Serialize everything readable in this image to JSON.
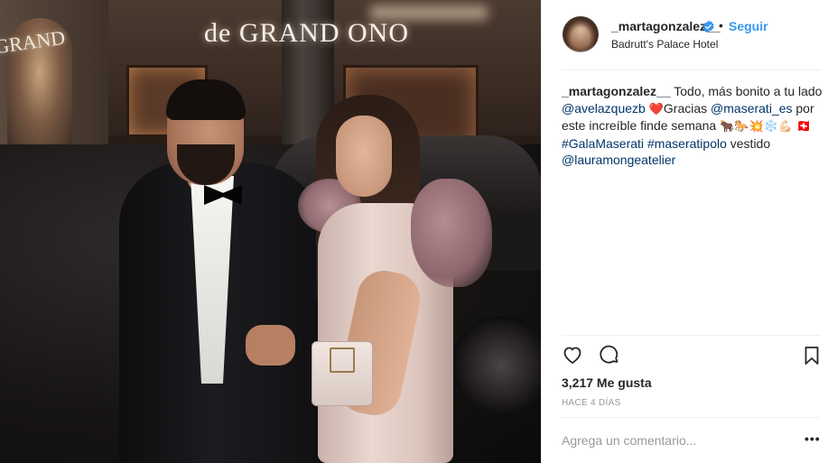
{
  "post": {
    "username": "_martagonzalez__",
    "follow_label": "Seguir",
    "separator_dot": "•",
    "location": "Badrutt's Palace Hotel",
    "caption": {
      "username": "_martagonzalez__",
      "text_1": " Todo, más bonito a tu lado ",
      "mention_1": "@avelazquezb",
      "emoji_heart": "❤️",
      "text_2": "Gracias ",
      "mention_2": "@maserati_es",
      "text_3": " por este increíble finde semana ",
      "emojis_1": "🐂🐎💥❄️💪🏻",
      "flag": "🇨🇭",
      "hashtag_1": "#GalaMaserati",
      "hashtag_2": "#maseratipolo",
      "text_4": " vestido ",
      "mention_3": "@lauramongeatelier"
    },
    "likes": "3,217 Me gusta",
    "time_ago": "HACE 4 DÍAS",
    "comment_placeholder": "Agrega un comentario...",
    "more_label": "•••"
  },
  "photo": {
    "sign_text": "de GRAND ONO",
    "sign_left_text": "GRAND"
  },
  "colors": {
    "link": "#003569",
    "follow": "#3897f0",
    "verified": "#3897f0",
    "muted": "#999999"
  },
  "icons": [
    "heart-icon",
    "comment-icon",
    "bookmark-icon",
    "verified-badge-icon",
    "more-options-icon"
  ]
}
